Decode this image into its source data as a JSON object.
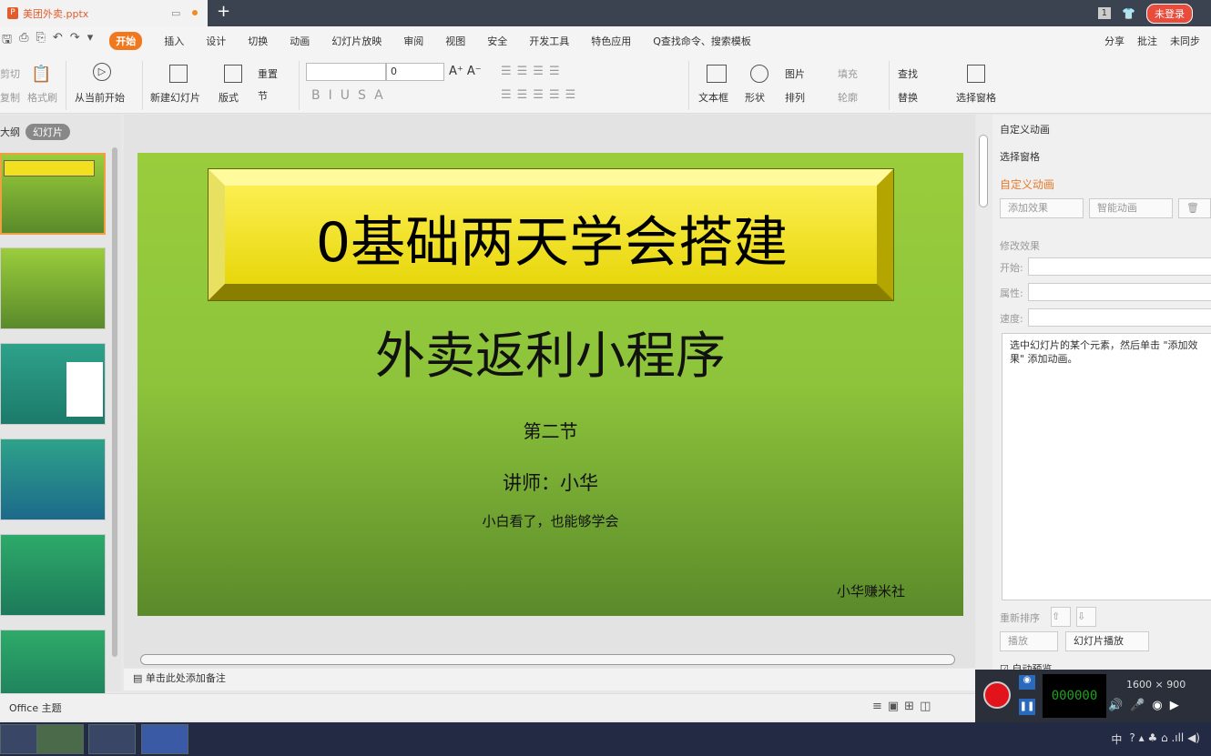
{
  "titlebar": {
    "file_name": "美团外卖.pptx",
    "new_tab": "+",
    "badge": "1",
    "login": "未登录"
  },
  "menubar": {
    "tabs": [
      "开始",
      "插入",
      "设计",
      "切换",
      "动画",
      "幻灯片放映",
      "审阅",
      "视图",
      "安全",
      "开发工具",
      "特色应用"
    ],
    "search": "Q查找命令、搜索模板",
    "right": [
      "分享",
      "批注",
      "未同步"
    ]
  },
  "ribbon": {
    "cut": "剪切",
    "copy": "复制",
    "format_painter": "格式刷",
    "play_from_current": "从当前开始",
    "new_slide": "新建幻灯片",
    "layout": "版式",
    "reset": "重置",
    "section": "节",
    "font_size": "0",
    "textbox": "文本框",
    "shape": "形状",
    "picture": "图片",
    "fill": "填充",
    "arrange": "排列",
    "outline": "轮廓",
    "find": "查找",
    "replace": "替换",
    "select_pane": "选择窗格"
  },
  "left_panel": {
    "tab_outline": "大纲",
    "tab_slides": "幻灯片"
  },
  "slide": {
    "title": "0基础两天学会搭建",
    "subtitle": "外卖返利小程序",
    "section": "第二节",
    "lecturer": "讲师：小华",
    "tagline": "小白看了，也能够学会",
    "brand": "小华赚米社"
  },
  "notes": {
    "placeholder": "单击此处添加备注"
  },
  "status": {
    "theme": "Office 主题"
  },
  "right_pane": {
    "header": "自定义动画",
    "select_pane": "选择窗格",
    "section_title": "自定义动画",
    "add_effect": "添加效果",
    "smart_animation": "智能动画",
    "modify": "修改效果",
    "start": "开始:",
    "property": "属性:",
    "speed": "速度:",
    "hint": "选中幻灯片的某个元素，然后单击 \"添加效果\" 添加动画。",
    "reorder": "重新排序",
    "play": "播放",
    "slideshow": "幻灯片播放",
    "auto_preview": "自动预览"
  },
  "recorder": {
    "time": "000000",
    "resolution": "1600 × 900"
  },
  "taskbar": {
    "tray": "中"
  }
}
